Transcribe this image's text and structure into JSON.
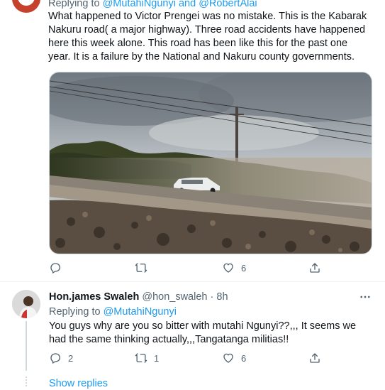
{
  "tweet1": {
    "replying_prefix": "Replying to",
    "replying_handles": "@MutahiNgunyi and @RobertAlai",
    "text": "What happened to Victor Prengei was no mistake. This is the Kabarak Nakuru road( a major highway). Three road accidents have happened here this week alone. This road has been like this for the past one year. It is a failure by the National and Nakuru county governments.",
    "actions": {
      "reply_count": "",
      "retweet_count": "",
      "like_count": "6"
    }
  },
  "tweet2": {
    "name": "Hon.james Swaleh",
    "handle": "@hon_swaleh",
    "separator": "·",
    "time": "8h",
    "replying_prefix": "Replying to",
    "replying_handles": "@MutahiNgunyi",
    "text": "You guys why are you so bitter with mutahi Ngunyi??,,, It seems we had the same thinking actually,,,Tangatanga militias!!",
    "actions": {
      "reply_count": "2",
      "retweet_count": "1",
      "like_count": "6"
    }
  },
  "show_replies": "Show replies",
  "icons": [
    "avatar",
    "reply-icon",
    "retweet-icon",
    "like-icon",
    "share-icon",
    "more-icon"
  ],
  "colors": {
    "link": "#1d9bf0",
    "muted": "#536471",
    "divider": "#eff3f4"
  }
}
